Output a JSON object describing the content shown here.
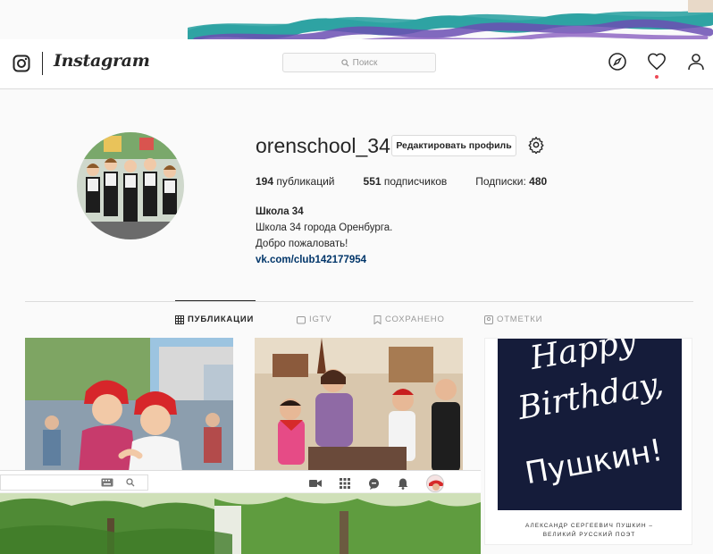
{
  "nav": {
    "brand": "Instagram",
    "search_placeholder": "Поиск",
    "icons": [
      "instagram-camera-icon",
      "compass-icon",
      "heart-icon",
      "person-icon"
    ]
  },
  "profile": {
    "username": "orenschool_34",
    "edit_button": "Редактировать профиль",
    "stats": {
      "posts_count": "194",
      "posts_label": "публикаций",
      "followers_count": "551",
      "followers_label": "подписчиков",
      "following_label": "Подписки:",
      "following_count": "480"
    },
    "bio": {
      "name": "Школа 34",
      "line1": "Школа 34 города Оренбурга.",
      "line2": "Добро пожаловать!",
      "link": "vk.com/club142177954"
    }
  },
  "tabs": [
    {
      "label": "ПУБЛИКАЦИИ",
      "icon": "grid-icon",
      "active": true
    },
    {
      "label": "IGTV",
      "icon": "tv-icon",
      "active": false
    },
    {
      "label": "СОХРАНЕНО",
      "icon": "bookmark-icon",
      "active": false
    },
    {
      "label": "ОТМЕТКИ",
      "icon": "tagged-icon",
      "active": false
    }
  ],
  "posts": {
    "birthday_lines": [
      "Happy",
      "Birthday,",
      "Пушкин!"
    ],
    "caption_line1": "АЛЕКСАНДР СЕРГЕЕВИЧ ПУШКИН –",
    "caption_line2": "ВЕЛИКИЙ РУССКИЙ ПОЭТ"
  },
  "overlay": {
    "icons": [
      "keyboard-icon",
      "search-icon",
      "video-camera-icon",
      "apps-grid-icon",
      "chat-icon",
      "bell-icon",
      "avatar"
    ]
  },
  "colors": {
    "link": "#003569",
    "notification": "#ed4956",
    "birthday_bg": "#151c3a",
    "scribble_teal": "#2fa3a3",
    "scribble_purple": "#6b4fb3"
  }
}
